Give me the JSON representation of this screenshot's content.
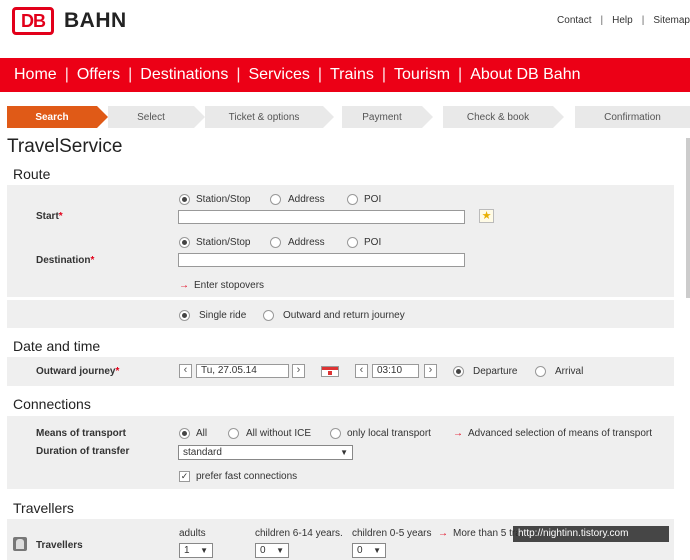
{
  "brand": {
    "logo": "DB",
    "name": "BAHN"
  },
  "toplinks": [
    "Contact",
    "Help",
    "Sitemap"
  ],
  "nav": [
    "Home",
    "Offers",
    "Destinations",
    "Services",
    "Trains",
    "Tourism",
    "About DB Bahn"
  ],
  "steps": [
    "Search",
    "Select",
    "Ticket & options",
    "Payment",
    "Check & book",
    "Confirmation"
  ],
  "page_title": "TravelService",
  "route": {
    "title": "Route",
    "start_label": "Start",
    "destination_label": "Destination",
    "required_mark": "*",
    "options": [
      "Station/Stop",
      "Address",
      "POI"
    ],
    "start_value": "",
    "destination_value": "",
    "stopovers_link": "Enter stopovers",
    "single_ride": "Single ride",
    "return_journey": "Outward and return journey"
  },
  "datetime": {
    "title": "Date and time",
    "outward_label": "Outward journey",
    "date": "Tu, 27.05.14",
    "time": "03:10",
    "departure": "Departure",
    "arrival": "Arrival"
  },
  "connections": {
    "title": "Connections",
    "means_label": "Means of transport",
    "all": "All",
    "all_without_ice": "All without ICE",
    "local": "only local transport",
    "advanced_link": "Advanced selection of means of transport",
    "transfer_label": "Duration of transfer",
    "transfer_value": "standard",
    "fast_connections": "prefer fast connections"
  },
  "travellers": {
    "title": "Travellers",
    "label": "Travellers",
    "adults_label": "adults",
    "children_6_14_label": "children 6-14 years.",
    "children_0_5_label": "children 0-5 years",
    "adults_value": "1",
    "children_6_14_value": "0",
    "children_0_5_value": "0",
    "more_link": "More than 5 tra"
  },
  "watermark": "http://nightinn.tistory.com",
  "colors": {
    "brand_red": "#ec0016",
    "active_step": "#e05a17"
  }
}
